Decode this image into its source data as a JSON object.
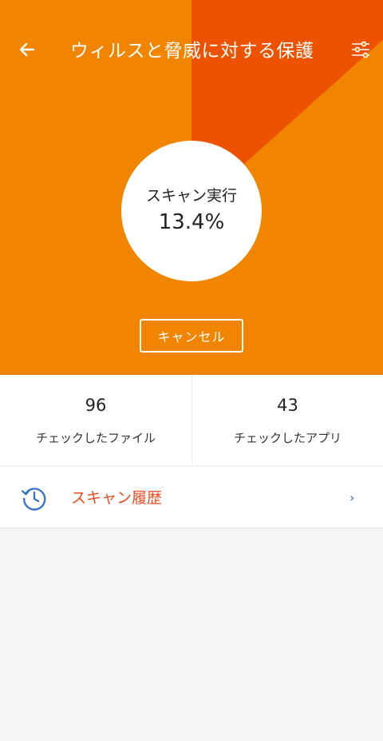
{
  "header": {
    "title": "ウィルスと脅威に対する保護"
  },
  "scan": {
    "label": "スキャン実行",
    "progress_text": "13.4%",
    "progress_fraction": 0.134,
    "cancel_label": "キャンセル"
  },
  "stats": {
    "files": {
      "value": "96",
      "label": "チェックしたファイル"
    },
    "apps": {
      "value": "43",
      "label": "チェックしたアプリ"
    }
  },
  "history": {
    "label": "スキャン履歴",
    "chevron": "›"
  },
  "icons": {
    "back": "arrow-left",
    "settings": "sliders",
    "history": "clock-history"
  },
  "colors": {
    "hero_background": "#f28500",
    "progress_sweep": "#ed5200",
    "history_label": "#ef4a1d",
    "accent_blue": "#3d73c9"
  }
}
